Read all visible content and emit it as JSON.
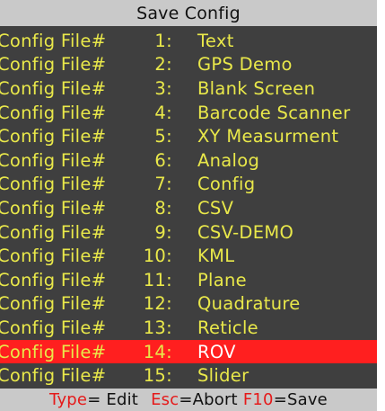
{
  "title": "Save Config",
  "colors": {
    "background": "#3f3f3f",
    "bar": "#c9c9c9",
    "text": "#e9e84a",
    "selection": "#ff1f1f",
    "key": "#e51a1a"
  },
  "list": {
    "prefix": "Config File#",
    "items": [
      {
        "num": "1:",
        "name": "Text"
      },
      {
        "num": "2:",
        "name": "GPS Demo"
      },
      {
        "num": "3:",
        "name": "Blank Screen"
      },
      {
        "num": "4:",
        "name": "Barcode Scanner"
      },
      {
        "num": "5:",
        "name": "XY Measurment"
      },
      {
        "num": "6:",
        "name": "Analog"
      },
      {
        "num": "7:",
        "name": "Config"
      },
      {
        "num": "8:",
        "name": "CSV"
      },
      {
        "num": "9:",
        "name": "CSV-DEMO"
      },
      {
        "num": "10:",
        "name": "KML"
      },
      {
        "num": "11:",
        "name": "Plane"
      },
      {
        "num": "12:",
        "name": "Quadrature"
      },
      {
        "num": "13:",
        "name": "Reticle"
      },
      {
        "num": "14:",
        "name": "ROV",
        "selected": true
      },
      {
        "num": "15:",
        "name": "Slider"
      }
    ]
  },
  "status": {
    "type_key": "Type",
    "type_action": "= Edit",
    "esc_key": "Esc",
    "esc_action": "=Abort",
    "f10_key": "F10",
    "f10_action": "=Save"
  }
}
